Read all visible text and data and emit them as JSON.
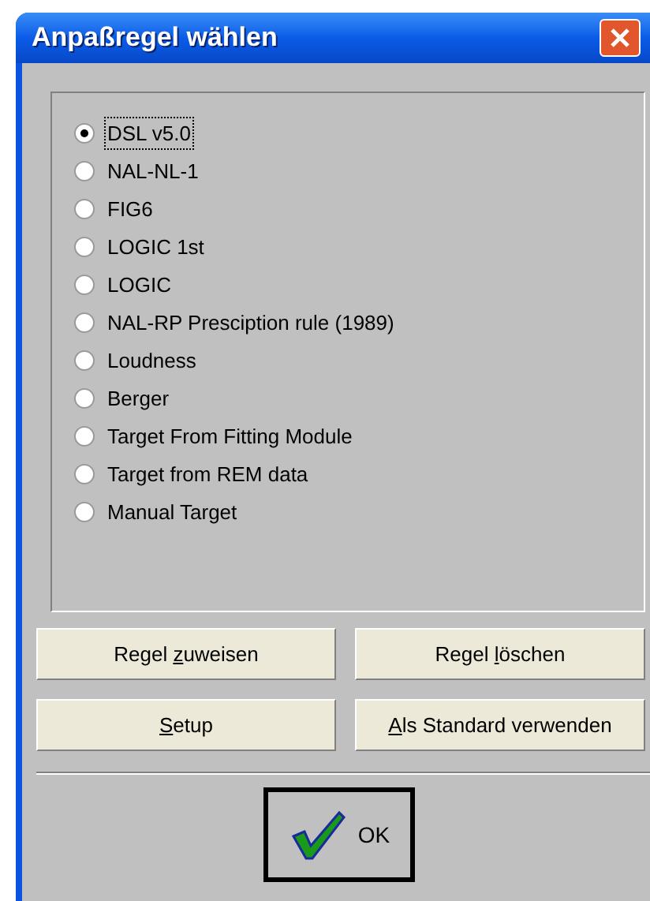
{
  "window": {
    "title": "Anpaßregel wählen"
  },
  "rules": [
    {
      "label": "DSL v5.0",
      "selected": true
    },
    {
      "label": "NAL-NL-1",
      "selected": false
    },
    {
      "label": "FIG6",
      "selected": false
    },
    {
      "label": "LOGIC 1st",
      "selected": false
    },
    {
      "label": "LOGIC",
      "selected": false
    },
    {
      "label": "NAL-RP Presciption rule (1989)",
      "selected": false
    },
    {
      "label": "Loudness",
      "selected": false
    },
    {
      "label": "Berger",
      "selected": false
    },
    {
      "label": "Target From Fitting Module",
      "selected": false
    },
    {
      "label": "Target from REM data",
      "selected": false
    },
    {
      "label": "Manual Target",
      "selected": false
    }
  ],
  "buttons": [
    {
      "before": "Regel ",
      "mnemonic": "z",
      "after": "uweisen"
    },
    {
      "before": "Regel ",
      "mnemonic": "l",
      "after": "öschen"
    },
    {
      "mnemonic": "S",
      "after": "etup"
    },
    {
      "mnemonic": "A",
      "after": "ls Standard verwenden"
    }
  ],
  "ok_button": {
    "label": "OK"
  }
}
